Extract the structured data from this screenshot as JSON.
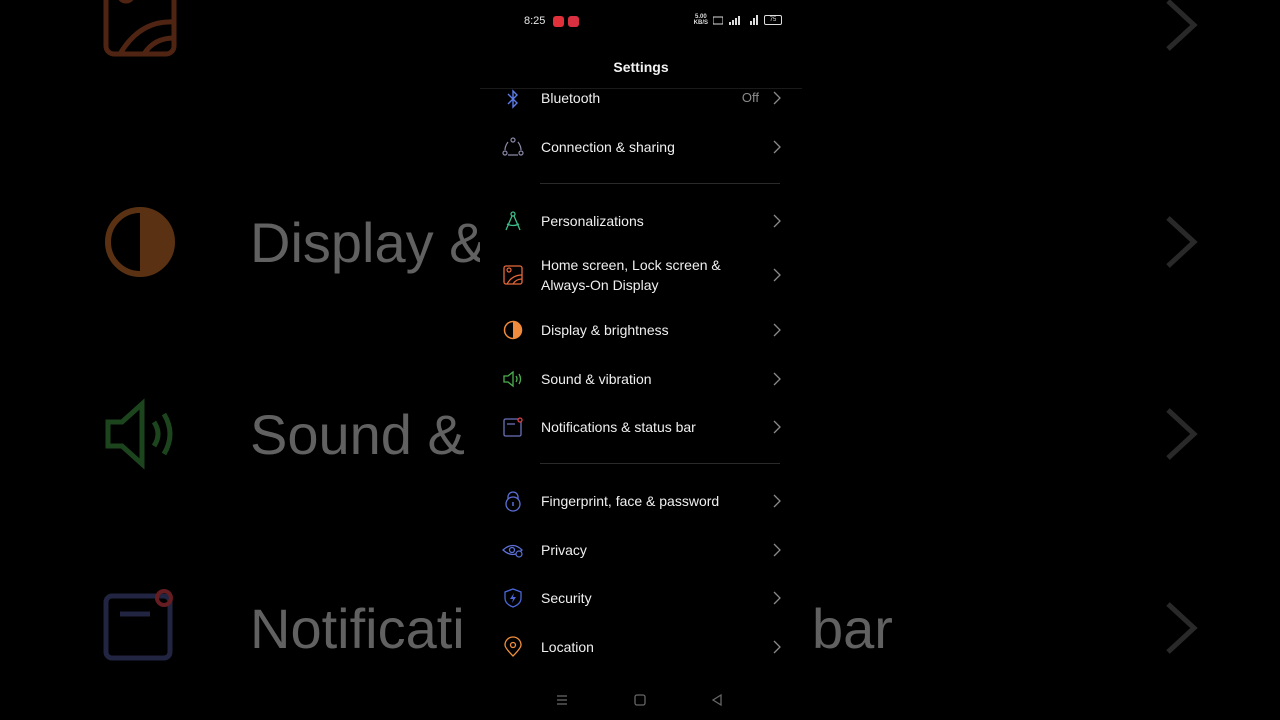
{
  "status_bar": {
    "time": "8:25",
    "speed_value": "5.00",
    "speed_unit": "KB/S",
    "battery": "75"
  },
  "header": {
    "title": "Settings"
  },
  "settings": {
    "bluetooth": {
      "label": "Bluetooth",
      "value": "Off",
      "icon": "bluetooth-icon",
      "color": "#5b7be6"
    },
    "connection": {
      "label": "Connection & sharing",
      "icon": "connection-sharing-icon",
      "color": "#8a8aa8"
    },
    "personalizations": {
      "label": "Personalizations",
      "icon": "compass-icon",
      "color": "#3fbf8a"
    },
    "home_screen": {
      "label_line1": "Home screen, Lock screen &",
      "label_line2": "Always-On Display",
      "icon": "picture-icon",
      "color": "#e8683a"
    },
    "display": {
      "label": "Display & brightness",
      "icon": "half-circle-icon",
      "color": "#f08a3c"
    },
    "sound": {
      "label": "Sound & vibration",
      "icon": "speaker-icon",
      "color": "#4caf50"
    },
    "notifications": {
      "label": "Notifications & status bar",
      "icon": "notification-icon",
      "color": "#6a72b8"
    },
    "fingerprint": {
      "label": "Fingerprint, face & password",
      "icon": "lock-icon",
      "color": "#5b6fd6"
    },
    "privacy": {
      "label": "Privacy",
      "icon": "eye-icon",
      "color": "#5b6fd6"
    },
    "security": {
      "label": "Security",
      "icon": "shield-icon",
      "color": "#4a66d8"
    },
    "location": {
      "label": "Location",
      "icon": "location-pin-icon",
      "color": "#f0903c"
    }
  },
  "background_echo": {
    "row1": "Home screen, Lock screen &",
    "row1b": "Always-On Display",
    "row2": "Display & brightness",
    "row3": "Sound & vibration",
    "row4": "Notifications & status bar"
  }
}
